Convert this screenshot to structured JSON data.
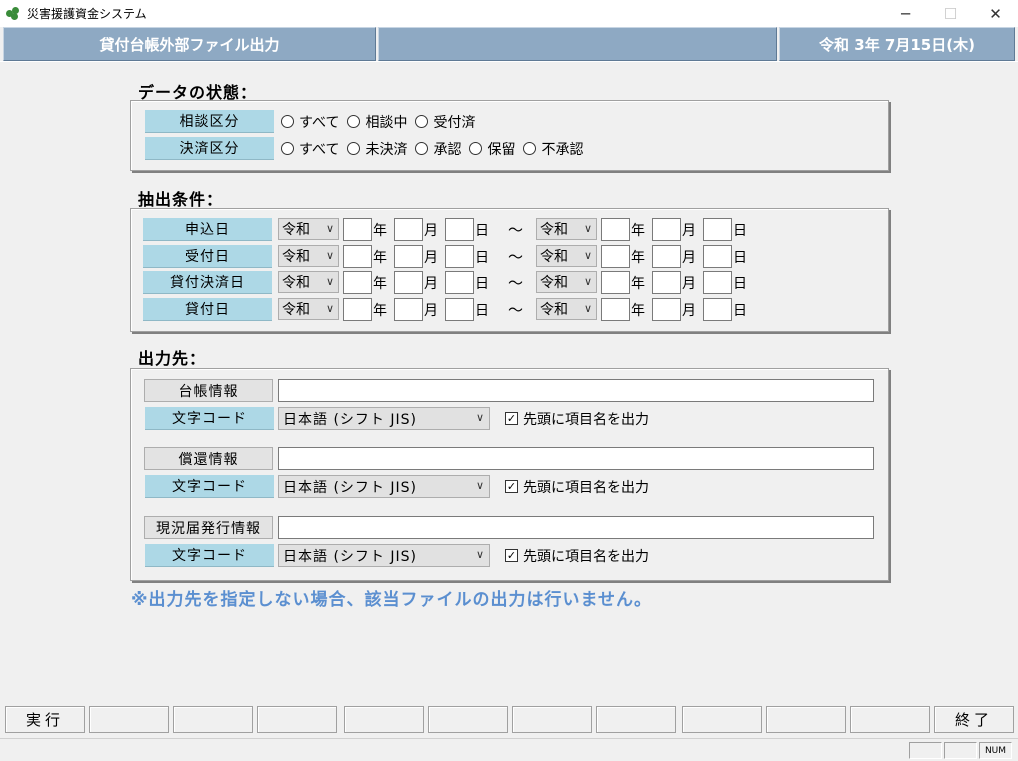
{
  "window": {
    "title": "災害援護資金システム"
  },
  "header": {
    "screen_title": "貸付台帳外部ファイル出力",
    "middle": "",
    "date": "令和 3年 7月15日(木)"
  },
  "status_section": {
    "title": "データの状態：",
    "rows": [
      {
        "label": "相談区分",
        "options": [
          "すべて",
          "相談中",
          "受付済"
        ]
      },
      {
        "label": "決済区分",
        "options": [
          "すべて",
          "未決済",
          "承認",
          "保留",
          "不承認"
        ]
      }
    ]
  },
  "extract_section": {
    "title": "抽出条件：",
    "era": "令和",
    "unit_year": "年",
    "unit_month": "月",
    "unit_day": "日",
    "tilde": "～",
    "rows": [
      {
        "label": "申込日"
      },
      {
        "label": "受付日"
      },
      {
        "label": "貸付決済日"
      },
      {
        "label": "貸付日"
      }
    ]
  },
  "output_section": {
    "title": "出力先：",
    "blocks": [
      {
        "button": "台帳情報",
        "path": "",
        "code_label": "文字コード",
        "encoding": "日本語 (シフト JIS)",
        "header_check": "先頭に項目名を出力"
      },
      {
        "button": "償還情報",
        "path": "",
        "code_label": "文字コード",
        "encoding": "日本語 (シフト JIS)",
        "header_check": "先頭に項目名を出力"
      },
      {
        "button": "現況届発行情報",
        "path": "",
        "code_label": "文字コード",
        "encoding": "日本語 (シフト JIS)",
        "header_check": "先頭に項目名を出力"
      }
    ],
    "note": "※出力先を指定しない場合、該当ファイルの出力は行いません。"
  },
  "function_keys": {
    "f1": "実行",
    "f12": "終了"
  },
  "statusbar": {
    "num": "NUM"
  }
}
